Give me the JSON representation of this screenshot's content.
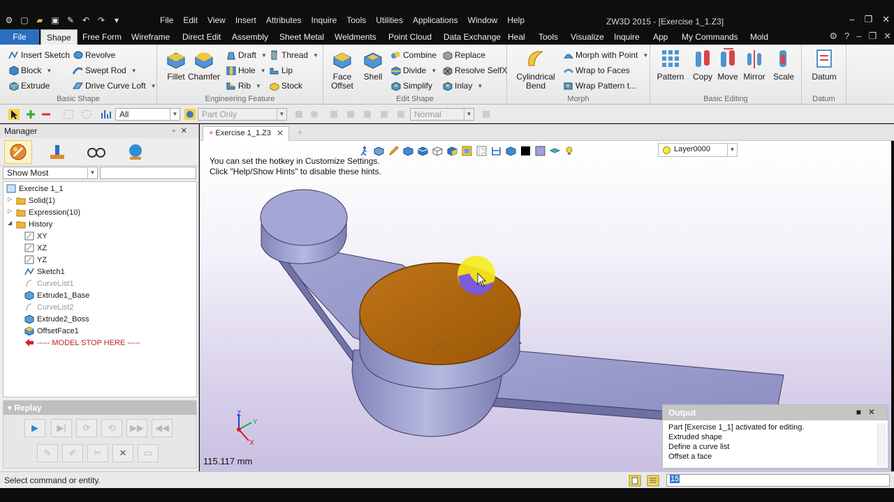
{
  "window": {
    "title": "ZW3D 2015 - [Exercise 1_1.Z3]",
    "menu": [
      "File",
      "Edit",
      "View",
      "Insert",
      "Attributes",
      "Inquire",
      "Tools",
      "Utilities",
      "Applications",
      "Window",
      "Help"
    ]
  },
  "ribbon_tabs": [
    "File",
    "Shape",
    "Free Form",
    "Wireframe",
    "Direct Edit",
    "Assembly",
    "Sheet Metal",
    "Weldments",
    "Point Cloud",
    "Data Exchange",
    "Heal",
    "Tools",
    "Visualize",
    "Inquire",
    "App",
    "My Commands",
    "Mold"
  ],
  "ribbon": {
    "basic_shape": {
      "label": "Basic Shape",
      "items": [
        "Insert Sketch",
        "Block",
        "Extrude",
        "Revolve",
        "Swept Rod",
        "Drive Curve Loft"
      ]
    },
    "engineering": {
      "label": "Engineering Feature",
      "big": [
        "Fillet",
        "Chamfer"
      ],
      "items": [
        "Draft",
        "Hole",
        "Rib",
        "Thread",
        "Lip",
        "Stock"
      ]
    },
    "edit_shape": {
      "label": "Edit Shape",
      "big": [
        "Face\nOffset",
        "Shell"
      ],
      "items": [
        "Combine",
        "Divide",
        "Simplify",
        "Replace",
        "Resolve SelfX",
        "Inlay"
      ]
    },
    "morph": {
      "label": "Morph",
      "big": [
        "Cylindrical\nBend"
      ],
      "items": [
        "Morph with Point",
        "Wrap to Faces",
        "Wrap Pattern t..."
      ]
    },
    "basic_editing": {
      "label": "Basic Editing",
      "big": [
        "Pattern",
        "Copy",
        "Move",
        "Mirror",
        "Scale"
      ]
    },
    "datum": {
      "label": "Datum",
      "big": [
        "Datum"
      ]
    }
  },
  "cmdbar": {
    "filter": "All",
    "part_only": "Part Only",
    "normal": "Normal"
  },
  "manager": {
    "title": "Manager",
    "show_filter": "Show Most",
    "tree": [
      {
        "label": "Exercise 1_1",
        "style": "normal"
      },
      {
        "label": "Solid(1)",
        "style": "normal"
      },
      {
        "label": "Expression(10)",
        "style": "normal"
      },
      {
        "label": "History",
        "style": "normal"
      },
      {
        "label": "XY",
        "style": "normal"
      },
      {
        "label": "XZ",
        "style": "normal"
      },
      {
        "label": "YZ",
        "style": "normal"
      },
      {
        "label": "Sketch1",
        "style": "normal"
      },
      {
        "label": "CurveList1",
        "style": "gray"
      },
      {
        "label": "Extrude1_Base",
        "style": "normal"
      },
      {
        "label": "CurveList2",
        "style": "gray"
      },
      {
        "label": "Extrude2_Boss",
        "style": "normal"
      },
      {
        "label": "OffsetFace1",
        "style": "normal"
      },
      {
        "label": "----- MODEL STOP HERE -----",
        "style": "red"
      }
    ],
    "replay_title": "Replay"
  },
  "document": {
    "tab": "Exercise 1_1.Z3"
  },
  "viewport": {
    "hint_line1": "You can set the hotkey in Customize Settings.",
    "hint_line2": "Click \"Help/Show Hints\" to disable these hints.",
    "layer": "Layer0000",
    "measure": "115.117 mm",
    "axis_x": "X",
    "axis_y": "Y",
    "axis_z": "Z"
  },
  "output": {
    "title": "Output",
    "lines": [
      "Part [Exercise 1_1] activated for editing.",
      "Extruded shape",
      "Define a curve list",
      "Offset a face"
    ]
  },
  "status": {
    "text": "Select command or entity.",
    "input": "15"
  },
  "colors": {
    "accent": "#2a6ebd",
    "model": "#9ea0cc",
    "highlight_face": "#b8660a"
  }
}
